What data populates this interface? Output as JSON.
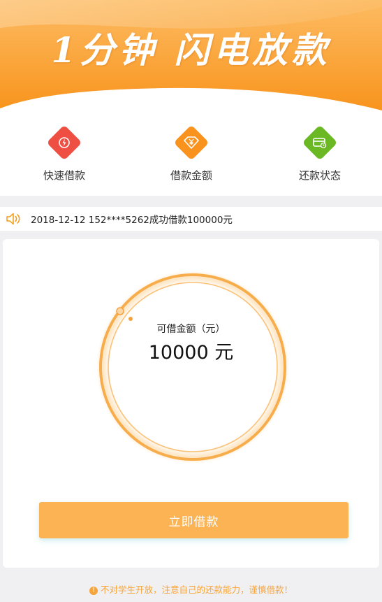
{
  "banner": {
    "title": "1分钟 闪电放款"
  },
  "menu": {
    "items": [
      {
        "label": "快速借款",
        "icon": "lightning-icon",
        "color": "#ee4f42"
      },
      {
        "label": "借款金额",
        "icon": "yen-tag-icon",
        "color": "#f9931e"
      },
      {
        "label": "还款状态",
        "icon": "card-status-icon",
        "color": "#6ab824"
      }
    ]
  },
  "notice": {
    "text": "2018-12-12 152****5262成功借款100000元",
    "icon": "speaker-icon"
  },
  "loan": {
    "label": "可借金额（元）",
    "amount": "10000 元"
  },
  "action": {
    "button_label": "立即借款"
  },
  "footer": {
    "warning_icon": "!",
    "text": "不对学生开放，注意自己的还款能力，谨慎借款！"
  },
  "colors": {
    "brand": "#f9931e",
    "button": "#fbb354",
    "warning": "#f7a53a"
  }
}
